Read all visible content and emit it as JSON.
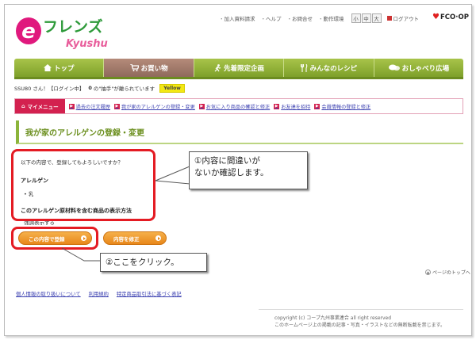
{
  "header": {
    "logo_e": "e",
    "logo_main": "フレンズ",
    "logo_sub": "Kyushu",
    "utility_links": [
      "加入資料請求",
      "ヘルプ",
      "お問合せ",
      "動作環境"
    ],
    "font_sizes": [
      "小",
      "中",
      "大"
    ],
    "logout": "ログアウト",
    "brand": "FCO·OP"
  },
  "nav": {
    "tabs": [
      {
        "label": "トップ",
        "icon": "home-icon"
      },
      {
        "label": "お買い物",
        "icon": "cart-icon"
      },
      {
        "label": "先着限定企画",
        "icon": "runner-icon"
      },
      {
        "label": "みんなのレシピ",
        "icon": "fork-knife-icon"
      },
      {
        "label": "おしゃべり広場",
        "icon": "chat-bubbles-icon"
      }
    ],
    "active_index": 1
  },
  "status": {
    "user": "SSU80 さん！【ログイン中】",
    "points": "0",
    "points_text": "の\"抽手\"が離られています",
    "badge": "Yellow"
  },
  "mymenu": {
    "label": "マイメニュー",
    "links": [
      "過去の注文履歴",
      "我が家のアレルゲンの登録・変更",
      "お気に入り商品の確認と修正",
      "お友達を招待",
      "会員情報の登録と修正"
    ]
  },
  "page": {
    "title": "我が家のアレルゲンの登録・変更",
    "confirm_question": "以下の内容で、登録してもよろしいですか？",
    "allergen_heading": "アレルゲン",
    "allergen_items": [
      "乳"
    ],
    "display_heading": "このアレルゲン原材料を含む商品の表示方法",
    "display_value": "強調表示する",
    "register_button": "この内容で登録",
    "edit_button": "内容を修正"
  },
  "annotations": {
    "callout1": "①内容に間違いが\nないか確認します。",
    "callout2": "②ここをクリック。",
    "accent": "#e41b23"
  },
  "footer": {
    "page_top": "ページのトップへ",
    "links": [
      "個人情報の取り扱いについて",
      "利用規約",
      "特定商品取引法に基づく表記"
    ],
    "copyright": "copyright (c) コープ九州事業連合 all right reserved",
    "notice": "このホームページ上の掲載の記事・写真・イラストなどの無断転載を禁じます。"
  }
}
